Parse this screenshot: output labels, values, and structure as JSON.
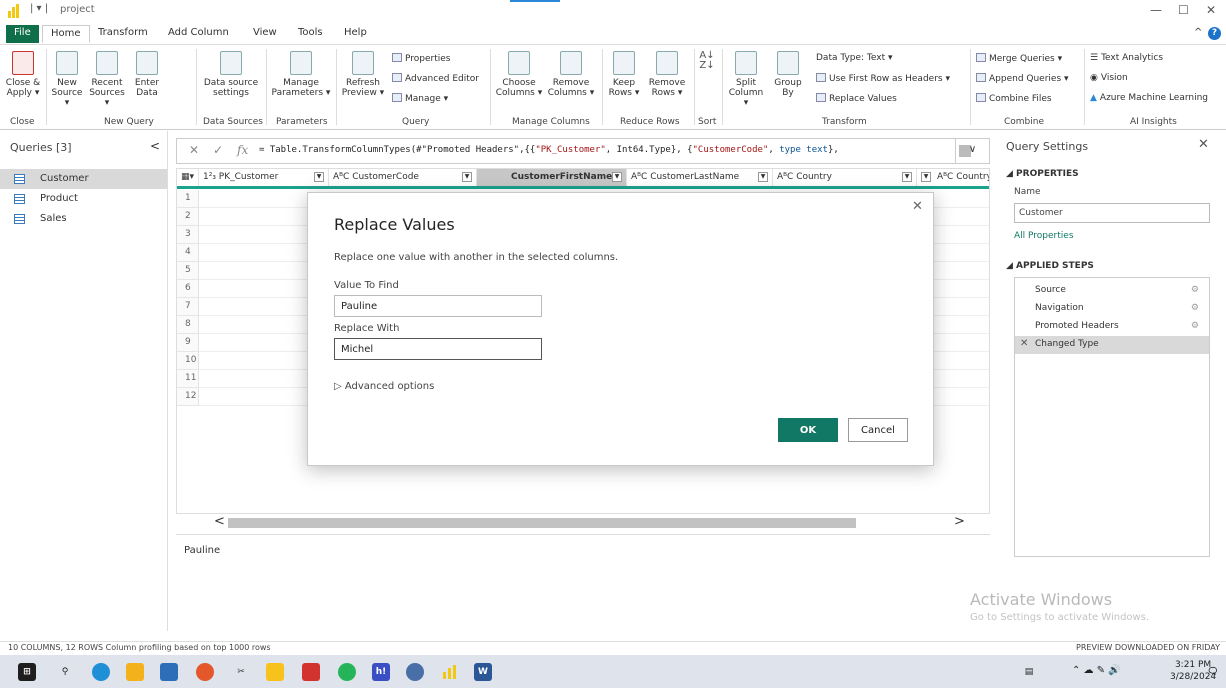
{
  "window": {
    "title": "project",
    "qat": "| ▾ |",
    "minimize": "—",
    "restore": "☐",
    "close": "✕",
    "collapse_ribbon": "^",
    "help": "?"
  },
  "menu_tabs": [
    "File",
    "Home",
    "Transform",
    "Add Column",
    "View",
    "Tools",
    "Help"
  ],
  "ribbon": {
    "close_apply": [
      "Close &",
      "Apply ▾"
    ],
    "new_source": [
      "New",
      "Source ▾"
    ],
    "recent_sources": [
      "Recent",
      "Sources ▾"
    ],
    "enter_data": [
      "Enter",
      "Data"
    ],
    "data_source_settings": [
      "Data source",
      "settings"
    ],
    "manage_parameters": [
      "Manage",
      "Parameters ▾"
    ],
    "refresh_preview": [
      "Refresh",
      "Preview ▾"
    ],
    "properties": "Properties",
    "advanced_editor": "Advanced Editor",
    "manage": "Manage ▾",
    "choose_columns": [
      "Choose",
      "Columns ▾"
    ],
    "remove_columns": [
      "Remove",
      "Columns ▾"
    ],
    "keep_rows": [
      "Keep",
      "Rows ▾"
    ],
    "remove_rows": [
      "Remove",
      "Rows ▾"
    ],
    "split_column": [
      "Split",
      "Column ▾"
    ],
    "group_by": [
      "Group",
      "By"
    ],
    "data_type": "Data Type: Text ▾",
    "use_first_row": "Use First Row as Headers ▾",
    "replace_values": "Replace Values",
    "merge_queries": "Merge Queries ▾",
    "append_queries": "Append Queries ▾",
    "combine_files": "Combine Files",
    "text_analytics": "Text Analytics",
    "vision": "Vision",
    "azure_ml": "Azure Machine Learning",
    "groups": [
      "Close",
      "New Query",
      "Data Sources",
      "Parameters",
      "Query",
      "Manage Columns",
      "Reduce Rows",
      "Sort",
      "Transform",
      "Combine",
      "AI Insights"
    ]
  },
  "queries": {
    "header": "Queries [3]",
    "collapse": "<",
    "items": [
      "Customer",
      "Product",
      "Sales"
    ]
  },
  "formula": {
    "cancel": "✕",
    "confirm": "✓",
    "fx": "fx",
    "text_prefix": "= Table.TransformColumnTypes(#\"Promoted Headers\",{{",
    "text_s1": "\"PK_Customer\"",
    "text_mid": ", Int64.Type}, {",
    "text_s2": "\"CustomerCode\"",
    "text_mid2": ", ",
    "text_k": "type text",
    "text_end": "},",
    "expand": "∨"
  },
  "grid": {
    "columns": [
      "1²₃ PK_Customer",
      "AᴮC CustomerCode",
      "CustomerFirstName",
      "AᴮC CustomerLastName",
      "AᴮC Country",
      "AᴮC CountryISO"
    ],
    "rows": [
      "1",
      "2",
      "3",
      "4",
      "5",
      "6",
      "7",
      "8",
      "9",
      "10",
      "11",
      "12"
    ],
    "scroll_left": "<",
    "scroll_right": ">",
    "preview_value": "Pauline"
  },
  "settings": {
    "title": "Query Settings",
    "close": "✕",
    "properties_header": "◢ PROPERTIES",
    "name_label": "Name",
    "name_value": "Customer",
    "all_properties": "All Properties",
    "applied_steps_header": "◢ APPLIED STEPS",
    "steps": [
      "Source",
      "Navigation",
      "Promoted Headers",
      "Changed Type"
    ],
    "gear": "⚙",
    "step_delete": "✕"
  },
  "watermark": {
    "line1": "Activate Windows",
    "line2": "Go to Settings to activate Windows."
  },
  "status": {
    "left": "10 COLUMNS, 12 ROWS    Column profiling based on top 1000 rows",
    "right": "PREVIEW DOWNLOADED ON FRIDAY"
  },
  "taskbar": {
    "time": "3:21 PM",
    "date": "3/28/2024",
    "hi_app": "h!",
    "word_app": "W",
    "tray": "⌃ ☁ ✎ 🔊"
  },
  "dialog": {
    "title": "Replace Values",
    "description": "Replace one value with another in the selected columns.",
    "value_to_find_label": "Value To Find",
    "value_to_find": "Pauline",
    "replace_with_label": "Replace With",
    "replace_with": "Michel",
    "advanced_options": "▷ Advanced options",
    "ok": "OK",
    "cancel": "Cancel",
    "close": "✕"
  },
  "colors": {
    "accent": "#117865",
    "file_tab": "#0f6f4a",
    "column_underline": "#1ba38d",
    "powerbi_yellow": "#f2c811"
  }
}
